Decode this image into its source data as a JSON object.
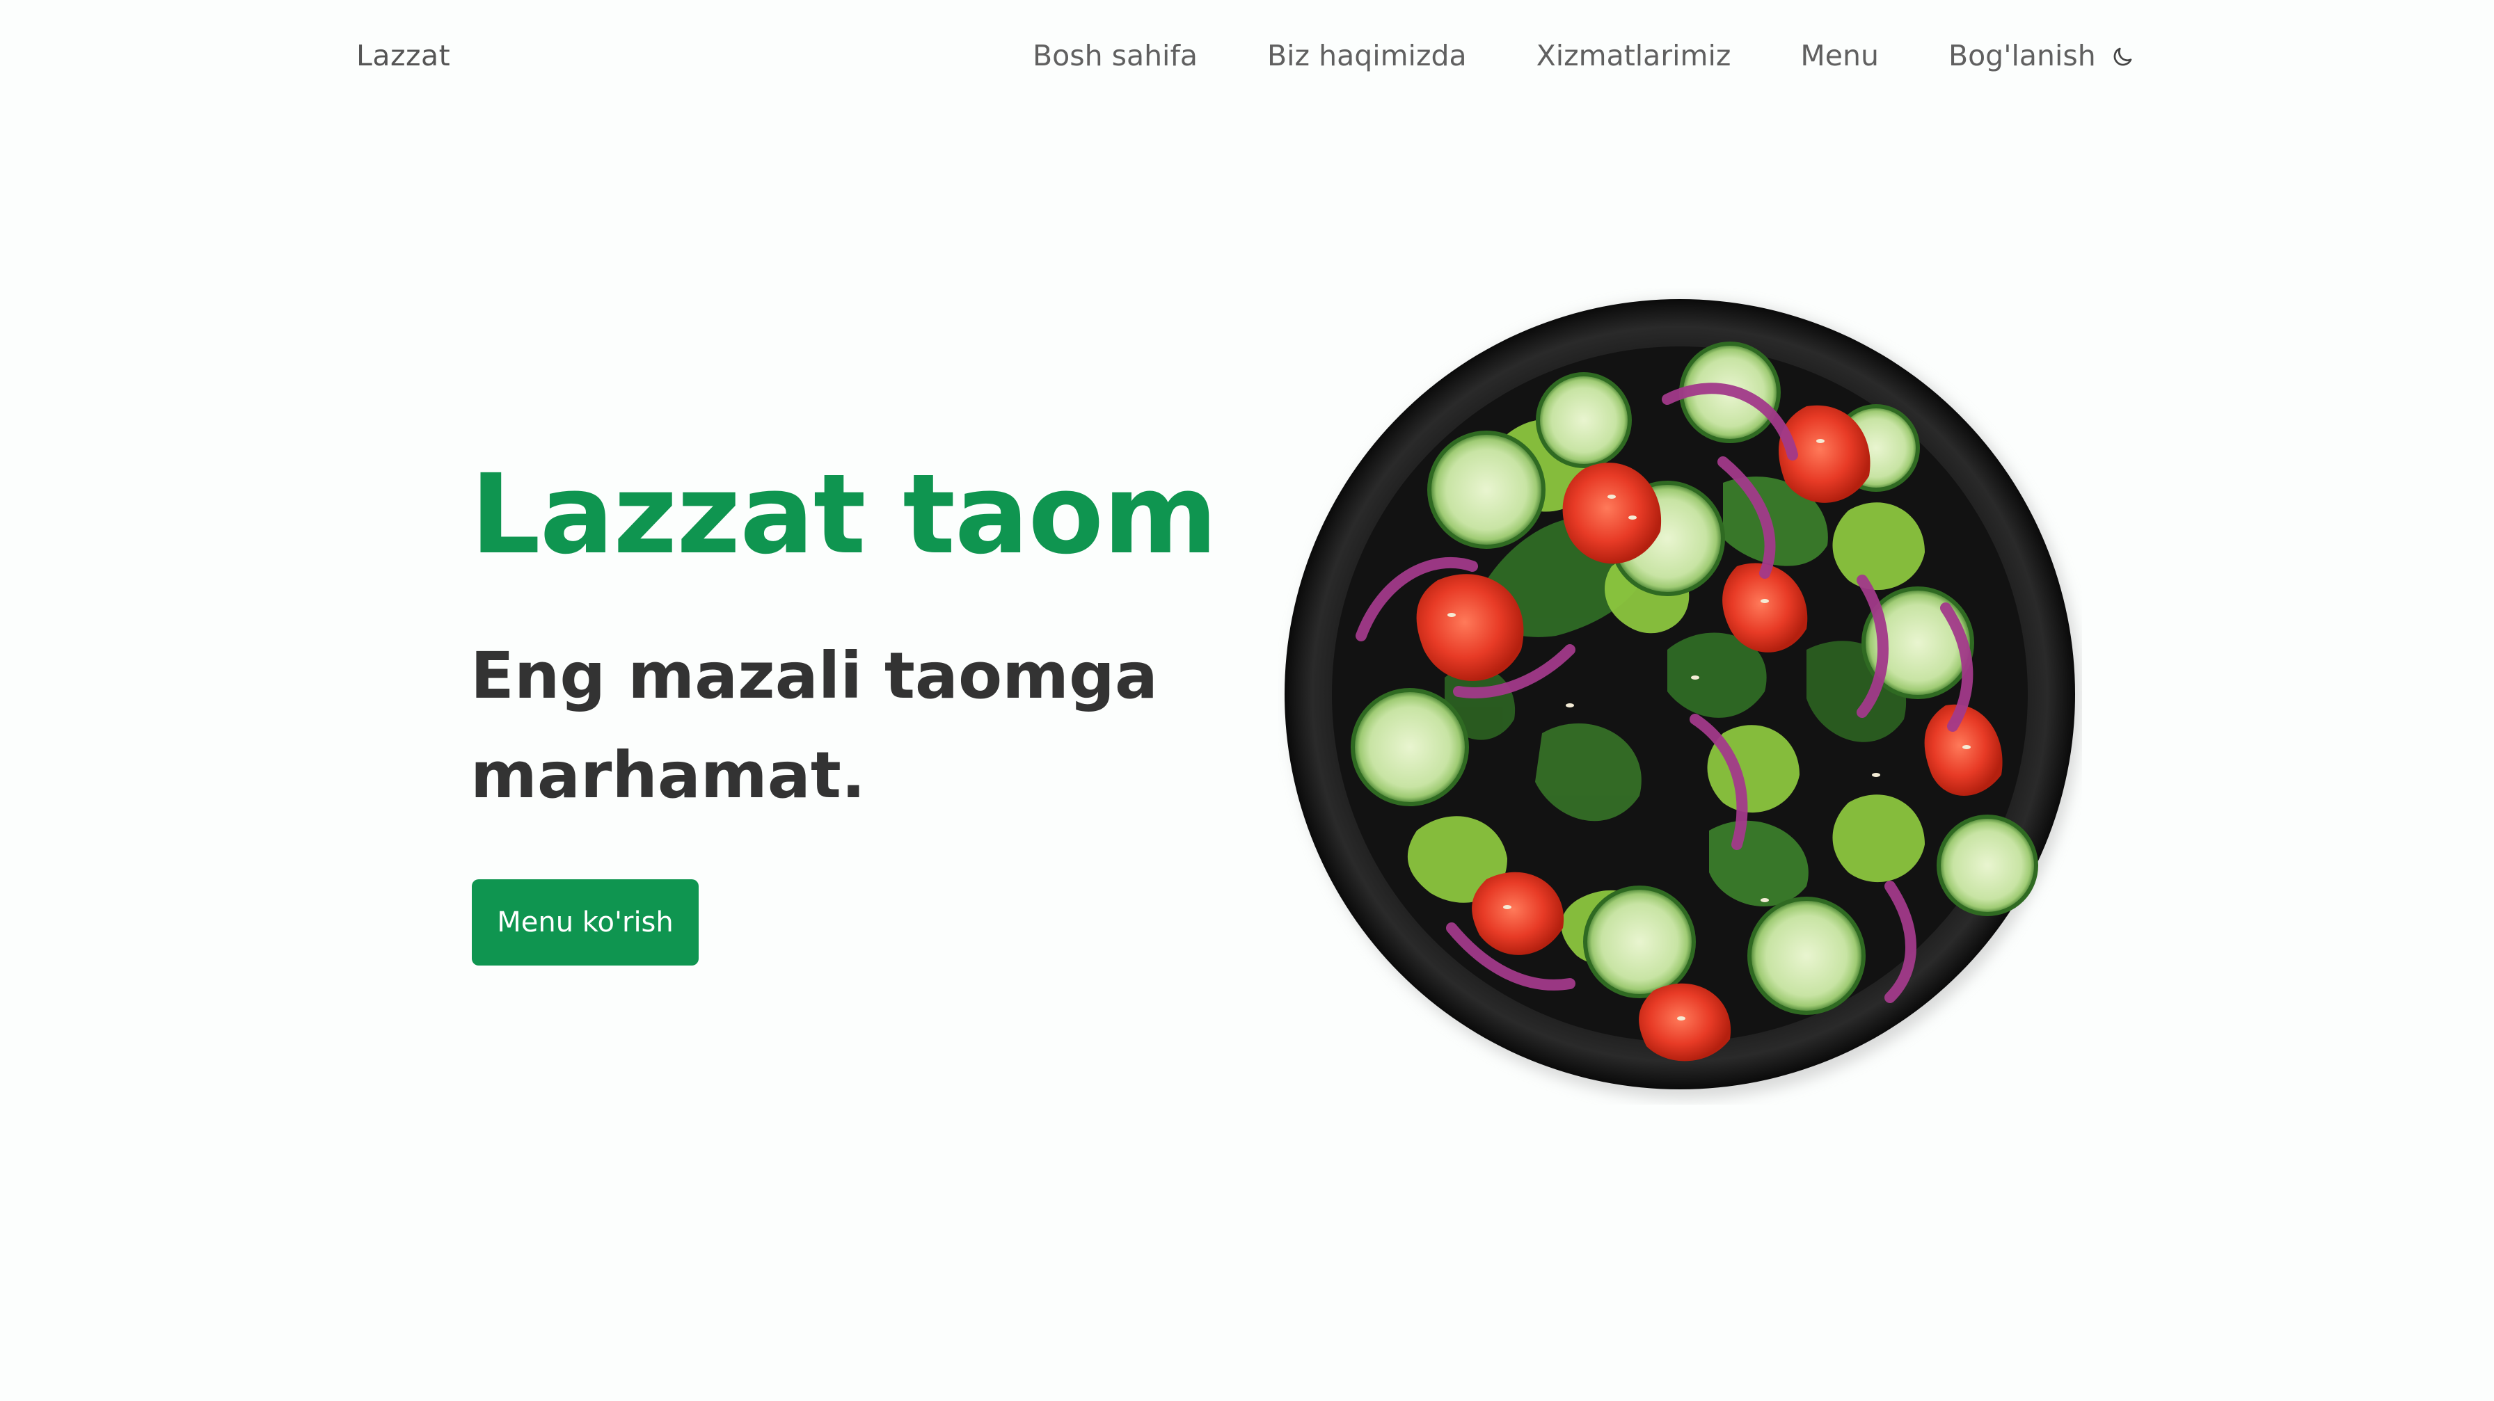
{
  "header": {
    "brand": "Lazzat",
    "nav": [
      {
        "label": "Bosh sahifa"
      },
      {
        "label": "Biz haqimizda"
      },
      {
        "label": "Xizmatlarimiz"
      },
      {
        "label": "Menu"
      },
      {
        "label": "Bog'lanish"
      }
    ],
    "theme_toggle_icon": "moon-icon"
  },
  "hero": {
    "title": "Lazzat taom",
    "subtitle": "Eng mazali taomga marhamat.",
    "cta_label": "Menu ko'rish",
    "image_icon": "salad-plate-image"
  },
  "colors": {
    "accent": "#0f9550",
    "heading_dark": "#333333",
    "nav_text": "#606060",
    "background": "#fcfefd"
  }
}
